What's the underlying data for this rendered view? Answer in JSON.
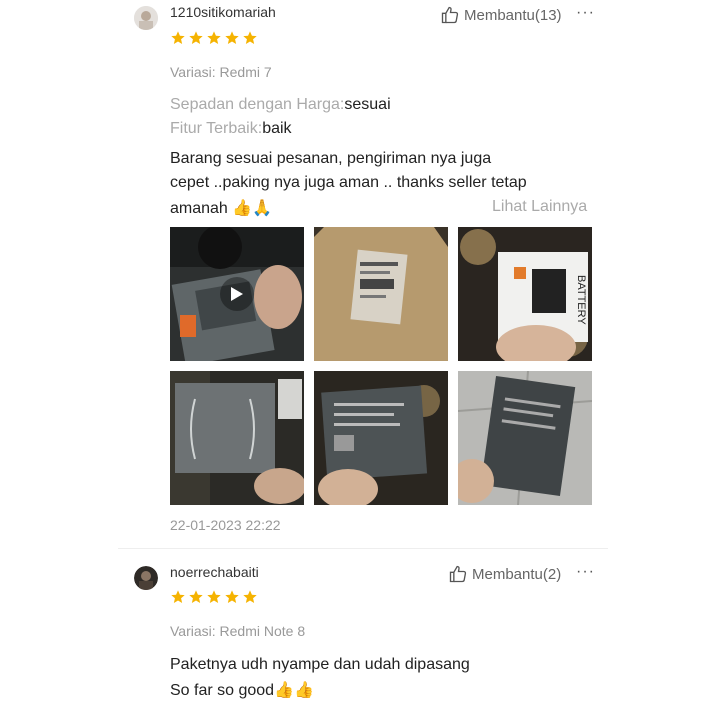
{
  "reviews": [
    {
      "username": "1210sitikomariah",
      "helpful_label": "Membantu(13)",
      "more": "···",
      "rating": 5,
      "variant": "Variasi: Redmi 7",
      "attributes": [
        {
          "key": "Sepadan dengan Harga:",
          "value": "sesuai"
        },
        {
          "key": "Fitur Terbaik:",
          "value": "baik"
        }
      ],
      "body_lines": [
        "Barang sesuai pesanan, pengiriman nya juga",
        "cepet ..paking nya juga aman .. thanks seller tetap",
        "amanah 👍🙏"
      ],
      "see_more": "Lihat Lainnya",
      "date": "22-01-2023 22:22",
      "media": [
        {
          "kind": "video",
          "icon": "play-icon"
        },
        {
          "kind": "photo",
          "icon": "package-photo"
        },
        {
          "kind": "photo",
          "icon": "battery-box-photo",
          "label": "BATTERY"
        },
        {
          "kind": "photo",
          "icon": "battery-back-photo"
        },
        {
          "kind": "photo",
          "icon": "battery-label-photo"
        },
        {
          "kind": "photo",
          "icon": "battery-front-photo"
        }
      ]
    },
    {
      "username": "noerrechabaiti",
      "helpful_label": "Membantu(2)",
      "more": "···",
      "rating": 5,
      "variant": "Variasi: Redmi Note 8",
      "body_lines": [
        "Paketnya udh nyampe dan udah dipasang",
        "So far so good👍👍"
      ]
    }
  ],
  "colors": {
    "star": "#f5b301",
    "muted": "#999999",
    "divider": "#eeeeee"
  }
}
